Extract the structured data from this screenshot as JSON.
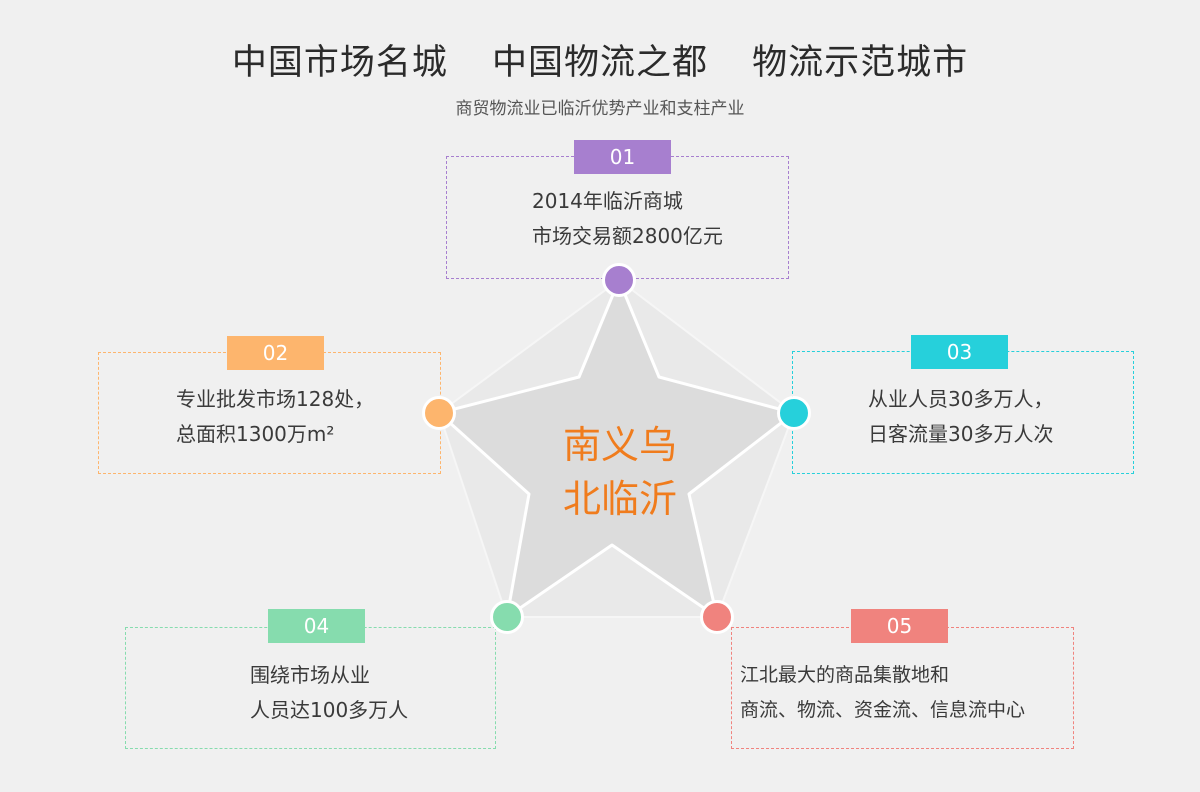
{
  "header": {
    "title_parts": [
      "中国市场名城",
      "中国物流之都",
      "物流示范城市"
    ],
    "subtitle": "商贸物流业已临沂优势产业和支柱产业"
  },
  "center": {
    "line1": "南义乌",
    "line2": "北临沂"
  },
  "items": [
    {
      "num": "01",
      "line1": "2014年临沂商城",
      "line2": "市场交易额2800亿元",
      "color": "#a77fcf"
    },
    {
      "num": "02",
      "line1": "专业批发市场128处，",
      "line2": "总面积1300万m²",
      "color": "#fdb56d"
    },
    {
      "num": "03",
      "line1": "从业人员30多万人，",
      "line2": "日客流量30多万人次",
      "color": "#26d0db"
    },
    {
      "num": "04",
      "line1": "围绕市场从业",
      "line2": "人员达100多万人",
      "color": "#86dcae"
    },
    {
      "num": "05",
      "line1": "江北最大的商品集散地和",
      "line2": "商流、物流、资金流、信息流中心",
      "color": "#f0837e"
    }
  ]
}
